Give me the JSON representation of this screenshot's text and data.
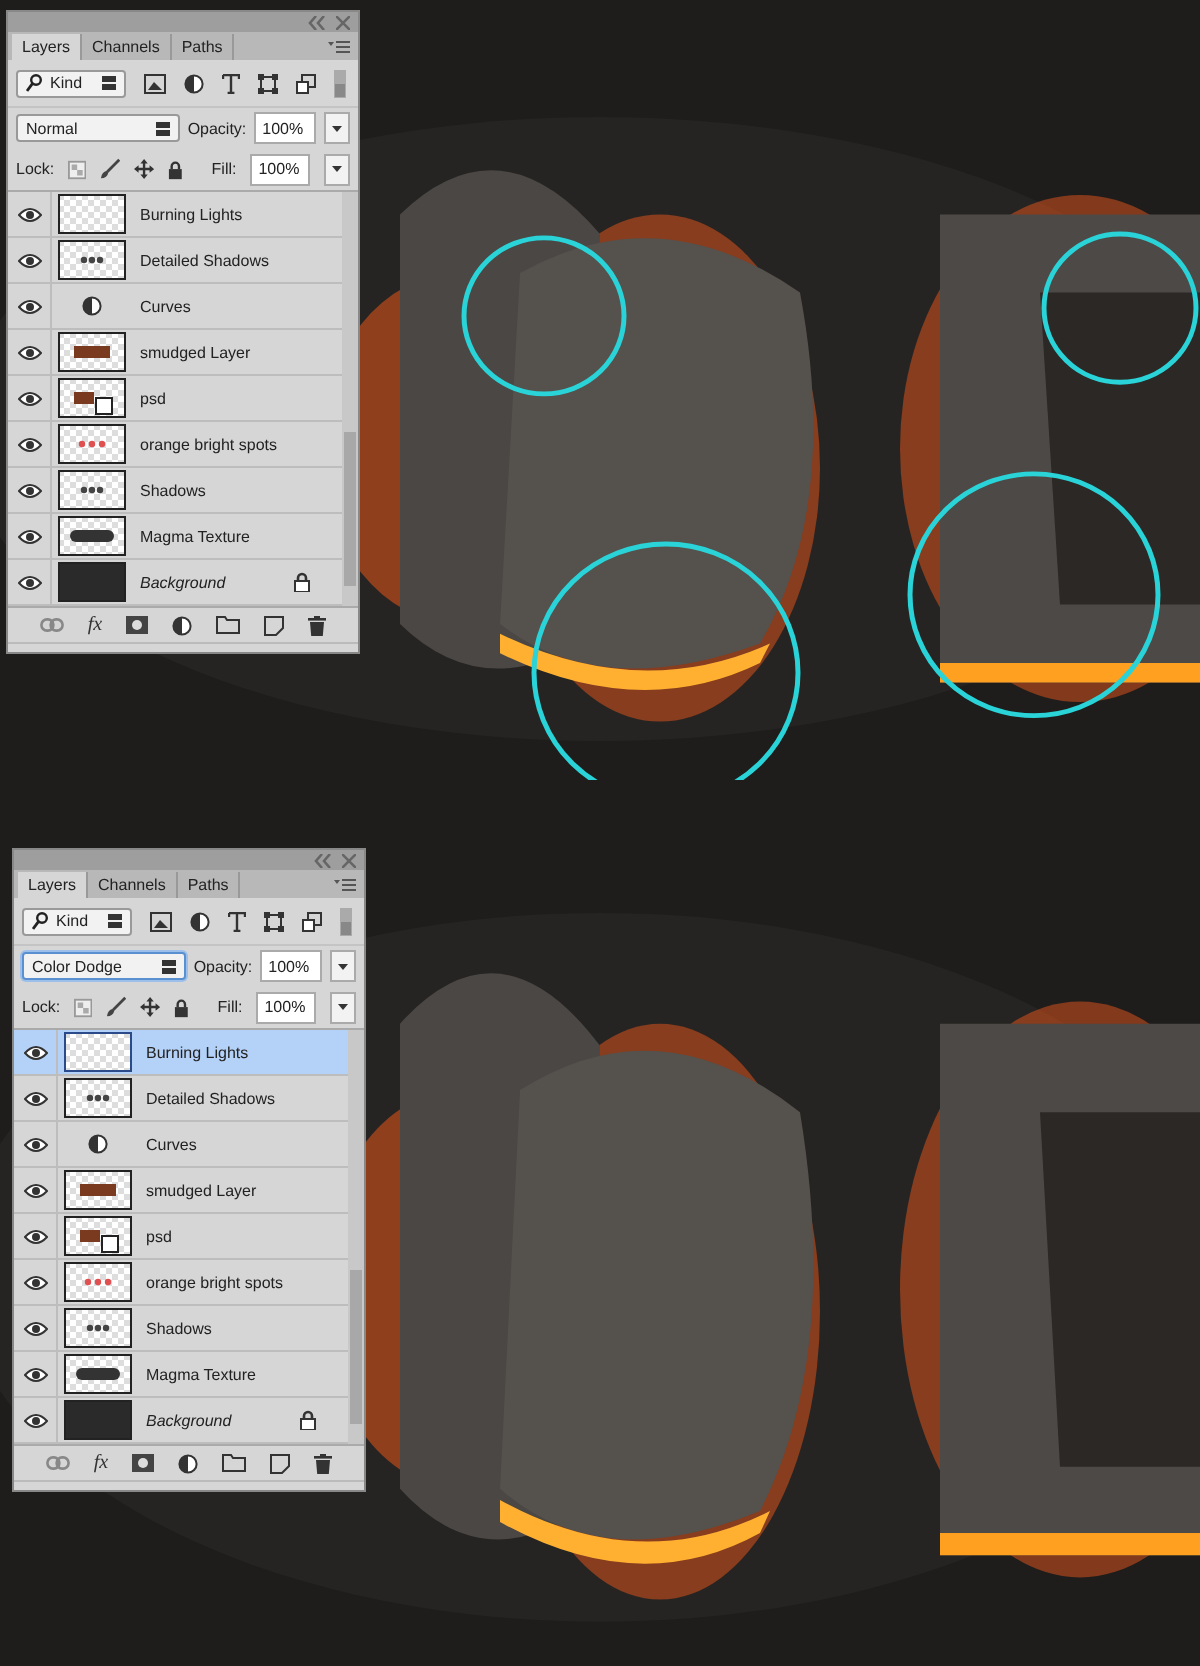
{
  "panels": [
    {
      "tabs": [
        {
          "label": "Layers",
          "selected": true
        },
        {
          "label": "Channels",
          "selected": false
        },
        {
          "label": "Paths",
          "selected": false
        }
      ],
      "filter": "Kind",
      "blend_mode": "Normal",
      "blend_focused": false,
      "opacity_label": "Opacity:",
      "opacity": "100%",
      "lock_label": "Lock:",
      "fill_label": "Fill:",
      "fill": "100%",
      "effects_label": "fx",
      "layers": [
        {
          "name": "Burning Lights",
          "kind": "pixel",
          "visible": true,
          "selected": false,
          "locked": false
        },
        {
          "name": "Detailed Shadows",
          "kind": "specks",
          "visible": true,
          "selected": false,
          "locked": false
        },
        {
          "name": "Curves",
          "kind": "adjustment",
          "visible": true,
          "selected": false,
          "locked": false
        },
        {
          "name": "smudged Layer",
          "kind": "lettering",
          "visible": true,
          "selected": false,
          "locked": false
        },
        {
          "name": "psd",
          "kind": "smart",
          "visible": true,
          "selected": false,
          "locked": false
        },
        {
          "name": "orange bright spots",
          "kind": "spots",
          "visible": true,
          "selected": false,
          "locked": false
        },
        {
          "name": "Shadows",
          "kind": "specks",
          "visible": true,
          "selected": false,
          "locked": false
        },
        {
          "name": "Magma Texture",
          "kind": "band",
          "visible": true,
          "selected": false,
          "locked": false
        },
        {
          "name": "Background",
          "kind": "dark",
          "visible": true,
          "selected": false,
          "locked": true
        }
      ]
    },
    {
      "tabs": [
        {
          "label": "Layers",
          "selected": true
        },
        {
          "label": "Channels",
          "selected": false
        },
        {
          "label": "Paths",
          "selected": false
        }
      ],
      "filter": "Kind",
      "blend_mode": "Color Dodge",
      "blend_focused": true,
      "opacity_label": "Opacity:",
      "opacity": "100%",
      "lock_label": "Lock:",
      "fill_label": "Fill:",
      "fill": "100%",
      "effects_label": "fx",
      "layers": [
        {
          "name": "Burning Lights",
          "kind": "pixel",
          "visible": true,
          "selected": true,
          "locked": false
        },
        {
          "name": "Detailed Shadows",
          "kind": "specks",
          "visible": true,
          "selected": false,
          "locked": false
        },
        {
          "name": "Curves",
          "kind": "adjustment",
          "visible": true,
          "selected": false,
          "locked": false
        },
        {
          "name": "smudged Layer",
          "kind": "lettering",
          "visible": true,
          "selected": false,
          "locked": false
        },
        {
          "name": "psd",
          "kind": "smart",
          "visible": true,
          "selected": false,
          "locked": false
        },
        {
          "name": "orange bright spots",
          "kind": "spots",
          "visible": true,
          "selected": false,
          "locked": false
        },
        {
          "name": "Shadows",
          "kind": "specks",
          "visible": true,
          "selected": false,
          "locked": false
        },
        {
          "name": "Magma Texture",
          "kind": "band",
          "visible": true,
          "selected": false,
          "locked": false
        },
        {
          "name": "Background",
          "kind": "dark",
          "visible": true,
          "selected": false,
          "locked": true
        }
      ]
    }
  ]
}
